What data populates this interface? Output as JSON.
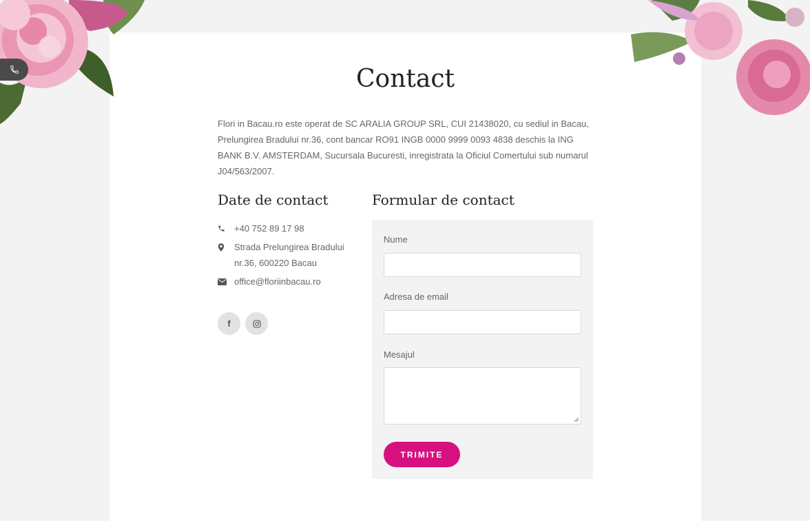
{
  "page": {
    "title": "Contact",
    "intro": "Flori in Bacau.ro este operat de SC ARALIA GROUP SRL, CUI 21438020, cu sediul in Bacau, Prelungirea Bradului nr.36, cont bancar RO91 INGB 0000 9999 0093 4838 deschis la ING BANK B.V. AMSTERDAM, Sucursala Bucuresti, inregistrata la Oficiul Comertului sub numarul J04/563/2007."
  },
  "contact": {
    "title": "Date de contact",
    "items": [
      {
        "icon": "phone-icon",
        "text": "+40 752 89 17 98"
      },
      {
        "icon": "map-pin-icon",
        "text": "Strada Prelungirea Bradului nr.36, 600220 Bacau"
      },
      {
        "icon": "envelope-icon",
        "text": "office@floriinbacau.ro"
      }
    ],
    "socials": [
      {
        "icon": "facebook-icon",
        "glyph": "f"
      },
      {
        "icon": "instagram-icon",
        "glyph": ""
      }
    ]
  },
  "form": {
    "title": "Formular de contact",
    "name_label": "Nume",
    "name_value": "",
    "email_label": "Adresa de email",
    "email_value": "",
    "message_label": "Mesajul",
    "message_value": "",
    "submit_label": "TRIMITE"
  },
  "floating": {
    "icon": "phone-icon"
  },
  "colors": {
    "accent": "#d6117f",
    "background": "#f3f3f3",
    "card": "#ffffff",
    "form_bg": "#f3f3f3",
    "floating_tab": "#4a4a4a"
  }
}
